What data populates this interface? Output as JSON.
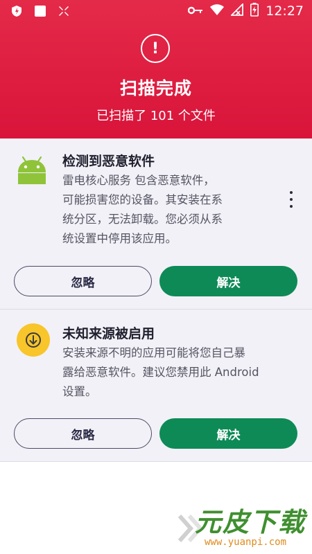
{
  "status_bar": {
    "time": "12:27",
    "left_icons": [
      "shield-icon",
      "square-icon",
      "tool-icon"
    ],
    "right_icons": [
      "key-icon",
      "wifi-icon",
      "no-signal-icon",
      "battery-charging-icon"
    ]
  },
  "header": {
    "icon": "warning-icon",
    "title": "扫描完成",
    "subtitle": "已扫描了 101 个文件",
    "color": "#e21f44"
  },
  "issues": [
    {
      "icon": "android-icon",
      "title": "检测到恶意软件",
      "description_lines": [
        "雷电核心服务 包含恶意软件，",
        "可能损害您的设备。其安装在系",
        "统分区，无法卸载。您必须从系",
        "统设置中停用该应用。"
      ],
      "ignore_label": "忽略",
      "fix_label": "解决"
    },
    {
      "icon": "download-icon",
      "title": "未知来源被启用",
      "description_lines": [
        "安装来源不明的应用可能将您自己暴",
        "露给恶意软件。建议您禁用此 Android",
        "设置。"
      ],
      "ignore_label": "忽略",
      "fix_label": "解决"
    }
  ],
  "colors": {
    "accent_green": "#0e8a57",
    "header_red": "#e21f44",
    "content_bg": "#f2f1f7"
  },
  "watermark": {
    "logo": "元皮下载",
    "url": "www.yuanpi.com"
  }
}
